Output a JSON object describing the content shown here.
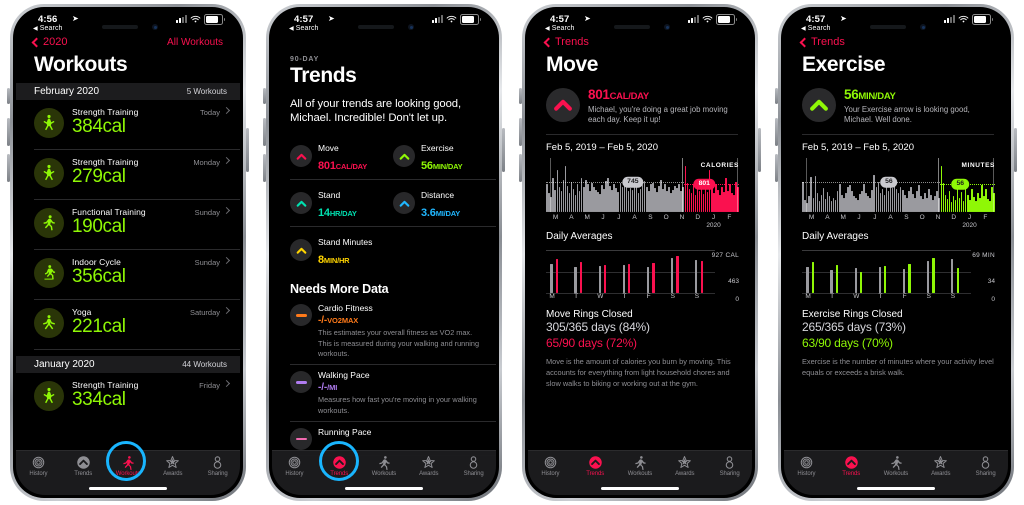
{
  "colors": {
    "move_pink": "#fa114f",
    "exercise_green": "#8ff706",
    "stand_cyan": "#00e0b0",
    "distance_blue": "#20b7ff",
    "stand_minutes_yellow": "#ffd400",
    "cardio_orange": "#ff7a1a",
    "walking_purple": "#b07cf0",
    "running_pink": "#f06ab0",
    "highlight_blue": "#19b5fe",
    "gray_bar": "#9a9a9f"
  },
  "tabbar": {
    "items": [
      {
        "label": "History",
        "icon": "history-rings-icon",
        "active": false
      },
      {
        "label": "Trends",
        "icon": "trends-arrow-icon",
        "active": false
      },
      {
        "label": "Workouts",
        "icon": "workouts-runner-icon",
        "active": false
      },
      {
        "label": "Awards",
        "icon": "awards-star-icon",
        "active": false
      },
      {
        "label": "Sharing",
        "icon": "sharing-people-icon",
        "active": false
      }
    ]
  },
  "panels": [
    {
      "status": {
        "time": "4:56",
        "back_app": "Search",
        "location_icon": "location-arrow-icon",
        "signal": "signal-bars-icon",
        "wifi": "wifi-icon",
        "battery": "battery-icon"
      },
      "nav": {
        "back_label": "2020",
        "right_label": "All Workouts"
      },
      "title": "Workouts",
      "active_tab": "Workouts",
      "sections": [
        {
          "month": "February 2020",
          "count": "5 Workouts",
          "workouts": [
            {
              "name": "Strength Training",
              "calories": "384cal",
              "day": "Today",
              "icon": "strength-training-icon"
            },
            {
              "name": "Strength Training",
              "calories": "279cal",
              "day": "Monday",
              "icon": "strength-training-icon"
            },
            {
              "name": "Functional Training",
              "calories": "190cal",
              "day": "Sunday",
              "icon": "functional-training-icon"
            },
            {
              "name": "Indoor Cycle",
              "calories": "356cal",
              "day": "Sunday",
              "icon": "indoor-cycle-icon"
            },
            {
              "name": "Yoga",
              "calories": "221cal",
              "day": "Saturday",
              "icon": "yoga-icon"
            }
          ]
        },
        {
          "month": "January 2020",
          "count": "44 Workouts",
          "workouts": [
            {
              "name": "Strength Training",
              "calories": "334cal",
              "day": "Friday",
              "icon": "strength-training-icon"
            }
          ]
        }
      ]
    },
    {
      "status": {
        "time": "4:57",
        "back_app": "Search"
      },
      "kicker": "90-DAY",
      "title": "Trends",
      "active_tab": "Trends",
      "blurb": "All of your trends are looking good, Michael. Incredible! Don't let up.",
      "metrics": [
        [
          {
            "label": "Move",
            "value": "801",
            "unit": "CAL/DAY",
            "color": "#fa114f",
            "arrow": "arrow-up-icon"
          },
          {
            "label": "Exercise",
            "value": "56",
            "unit": "MIN/DAY",
            "color": "#8ff706",
            "arrow": "arrow-up-icon"
          }
        ],
        [
          {
            "label": "Stand",
            "value": "14",
            "unit": "HR/DAY",
            "color": "#00e0b0",
            "arrow": "arrow-up-icon"
          },
          {
            "label": "Distance",
            "value": "3.6",
            "unit": "MI/DAY",
            "color": "#20b7ff",
            "arrow": "arrow-up-icon"
          }
        ],
        [
          {
            "label": "Stand Minutes",
            "value": "8",
            "unit": "MIN/HR",
            "color": "#ffd400",
            "arrow": "arrow-up-icon"
          }
        ]
      ],
      "needs_more_data": {
        "heading": "Needs More Data",
        "items": [
          {
            "title": "Cardio Fitness",
            "value": "-/-",
            "unit": "VO2MAX",
            "color": "#ff7a1a",
            "desc": "This estimates your overall fitness as VO2 max. This is measured during your walking and running workouts."
          },
          {
            "title": "Walking Pace",
            "value": "-/-",
            "unit": "/MI",
            "color": "#b07cf0",
            "desc": "Measures how fast you're moving in your walking workouts."
          },
          {
            "title": "Running Pace",
            "value": "",
            "unit": "",
            "color": "#f06ab0",
            "desc": ""
          }
        ]
      }
    },
    {
      "status": {
        "time": "4:57",
        "back_app": "Search"
      },
      "nav": {
        "back_label": "Trends"
      },
      "title": "Move",
      "active_tab": "Trends",
      "hero": {
        "value": "801",
        "unit": "CAL/DAY",
        "color": "#fa114f",
        "desc": "Michael, you're doing a great job moving each day. Keep it up!",
        "arrow": "arrow-up-icon"
      },
      "date_range": "Feb 5, 2019 – Feb 5, 2020",
      "daily_averages_label": "Daily Averages",
      "rings": {
        "title": "Move Rings Closed",
        "year": "305/365 days (84%)",
        "period": "65/90 days (72%)"
      },
      "footnote": "Move is the amount of calories you burn by moving. This accounts for everything from light household chores and slow walks to biking or working out at the gym.",
      "chart_data": {
        "type": "bar",
        "title": "Move – Feb 5, 2019 – Feb 5, 2020",
        "ylabel": "CALORIES",
        "xlabel": "",
        "units": "CALORIES",
        "baseline_label": "745",
        "highlight_label": "801",
        "baseline_value": 745,
        "highlight_value": 801,
        "accent_color": "#fa114f",
        "base_color": "#9a9a9f",
        "month_ticks": [
          "M",
          "A",
          "M",
          "J",
          "J",
          "A",
          "S",
          "O",
          "N",
          "D",
          "J",
          "F"
        ],
        "year_tick": "2020",
        "values": [
          58,
          40,
          32,
          72,
          47,
          88,
          52,
          44,
          66,
          96,
          54,
          40,
          62,
          49,
          36,
          58,
          44,
          70,
          52,
          66,
          58,
          44,
          60,
          52,
          46,
          42,
          38,
          56,
          48,
          64,
          70,
          54,
          46,
          58,
          50,
          42,
          60,
          52,
          68,
          58,
          44,
          50,
          46,
          62,
          54,
          40,
          48,
          56,
          64,
          52,
          44,
          58,
          60,
          50,
          42,
          54,
          66,
          48,
          58,
          44,
          52,
          40,
          46,
          54,
          50,
          58,
          44,
          52,
          96,
          60,
          48,
          40,
          58,
          36,
          50,
          44,
          62,
          38,
          54,
          42,
          88,
          50,
          40,
          58,
          46,
          36,
          52,
          42,
          70,
          44,
          58,
          40,
          36,
          62,
          52
        ],
        "highlight_start_index": 68
      },
      "daily_chart_data": {
        "type": "bar",
        "title": "Daily Averages",
        "units": "CAL",
        "axis_labels": [
          "927 CAL",
          "463",
          "0"
        ],
        "ymax": 927,
        "categories": [
          "M",
          "T",
          "W",
          "T",
          "F",
          "S",
          "S"
        ],
        "series": [
          {
            "name": "365-day average",
            "color": "#9a9a9f",
            "values": [
              700,
              620,
              640,
              660,
              620,
              830,
              790
            ]
          },
          {
            "name": "90-day average",
            "color": "#fa114f",
            "values": [
              800,
              730,
              660,
              690,
              720,
              880,
              760
            ]
          }
        ]
      }
    },
    {
      "status": {
        "time": "4:57",
        "back_app": "Search"
      },
      "nav": {
        "back_label": "Trends"
      },
      "title": "Exercise",
      "active_tab": "Trends",
      "hero": {
        "value": "56",
        "unit": "MIN/DAY",
        "color": "#8ff706",
        "desc": "Your Exercise arrow is looking good, Michael. Well done.",
        "arrow": "arrow-up-icon"
      },
      "date_range": "Feb 5, 2019 – Feb 5, 2020",
      "daily_averages_label": "Daily Averages",
      "rings": {
        "title": "Exercise Rings Closed",
        "year": "265/365 days (73%)",
        "period": "63/90 days (70%)"
      },
      "footnote": "Exercise is the number of minutes where your activity level equals or exceeds a brisk walk.",
      "chart_data": {
        "type": "bar",
        "title": "Exercise – Feb 5, 2019 – Feb 5, 2020",
        "ylabel": "MINUTES",
        "xlabel": "",
        "units": "MINUTES",
        "baseline_label": "56",
        "highlight_label": "56",
        "baseline_value": 56,
        "highlight_value": 56,
        "accent_color": "#8ff706",
        "base_color": "#9a9a9f",
        "month_ticks": [
          "M",
          "A",
          "M",
          "J",
          "J",
          "A",
          "S",
          "O",
          "N",
          "D",
          "J",
          "F"
        ],
        "year_tick": "2020",
        "values": [
          62,
          26,
          18,
          34,
          74,
          30,
          76,
          40,
          24,
          36,
          50,
          28,
          42,
          34,
          22,
          30,
          26,
          44,
          58,
          36,
          30,
          40,
          52,
          56,
          44,
          34,
          30,
          26,
          38,
          44,
          58,
          40,
          34,
          30,
          46,
          78,
          52,
          62,
          40,
          48,
          36,
          56,
          44,
          64,
          50,
          58,
          48,
          40,
          52,
          46,
          36,
          30,
          44,
          52,
          38,
          30,
          44,
          56,
          34,
          28,
          40,
          30,
          48,
          36,
          26,
          34,
          44,
          30,
          96,
          60,
          36,
          28,
          44,
          20,
          34,
          26,
          50,
          30,
          42,
          24,
          66,
          36,
          26,
          48,
          32,
          22,
          40,
          30,
          56,
          34,
          48,
          28,
          22,
          52,
          40
        ],
        "highlight_start_index": 68
      },
      "daily_chart_data": {
        "type": "bar",
        "title": "Daily Averages",
        "units": "MIN",
        "axis_labels": [
          "69 MIN",
          "34",
          "0"
        ],
        "ymax": 69,
        "categories": [
          "M",
          "T",
          "W",
          "T",
          "F",
          "S",
          "S"
        ],
        "series": [
          {
            "name": "365-day average",
            "color": "#9a9a9f",
            "values": [
              46,
              40,
              44,
              46,
              42,
              56,
              60
            ]
          },
          {
            "name": "90-day average",
            "color": "#8ff706",
            "values": [
              54,
              50,
              38,
              48,
              52,
              62,
              44
            ]
          }
        ]
      }
    }
  ]
}
